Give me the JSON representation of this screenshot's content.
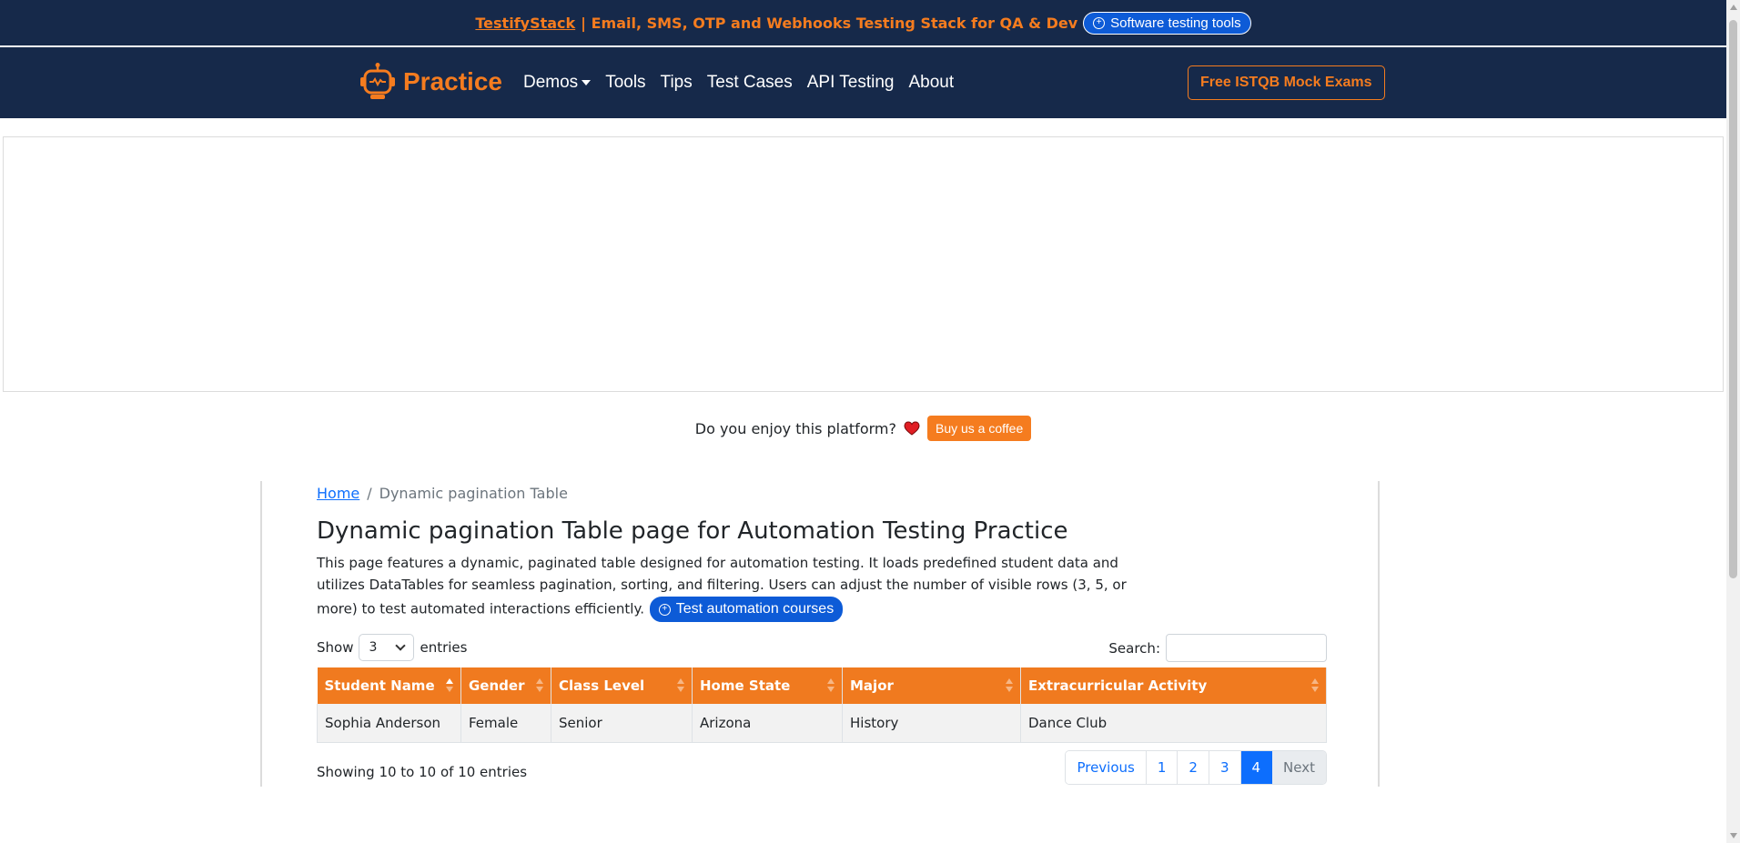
{
  "announcement": {
    "brand": "TestifyStack",
    "text": " | Email, SMS, OTP and Webhooks Testing Stack for QA & Dev",
    "pill_label": "Software testing tools"
  },
  "navbar": {
    "logo_text": "Practice",
    "links": [
      "Demos",
      "Tools",
      "Tips",
      "Test Cases",
      "API Testing",
      "About"
    ],
    "cta": "Free ISTQB Mock Exams"
  },
  "enjoy": {
    "question": "Do you enjoy this platform?",
    "coffee_button": "Buy us a coffee"
  },
  "breadcrumb": {
    "home": "Home",
    "separator": "/",
    "current": "Dynamic pagination Table"
  },
  "page": {
    "title": "Dynamic pagination Table page for Automation Testing Practice",
    "description": "This page features a dynamic, paginated table designed for automation testing. It loads predefined student data and utilizes DataTables for seamless pagination, sorting, and filtering. Users can adjust the number of visible rows (3, 5, or more) to test automated interactions efficiently.",
    "courses_pill": "Test automation courses"
  },
  "table_controls": {
    "show_label": "Show",
    "entries_label": "entries",
    "selected_page_size": "3",
    "search_label": "Search:",
    "search_value": ""
  },
  "table": {
    "headers": [
      "Student Name",
      "Gender",
      "Class Level",
      "Home State",
      "Major",
      "Extracurricular Activity"
    ],
    "rows": [
      [
        "Sophia Anderson",
        "Female",
        "Senior",
        "Arizona",
        "History",
        "Dance Club"
      ]
    ]
  },
  "pagination": {
    "info": "Showing 10 to 10 of 10 entries",
    "previous": "Previous",
    "pages": [
      "1",
      "2",
      "3",
      "4"
    ],
    "active_page": "4",
    "next": "Next"
  },
  "colors": {
    "navy": "#16294a",
    "orange": "#f57c1f",
    "blue": "#0d6efd"
  }
}
